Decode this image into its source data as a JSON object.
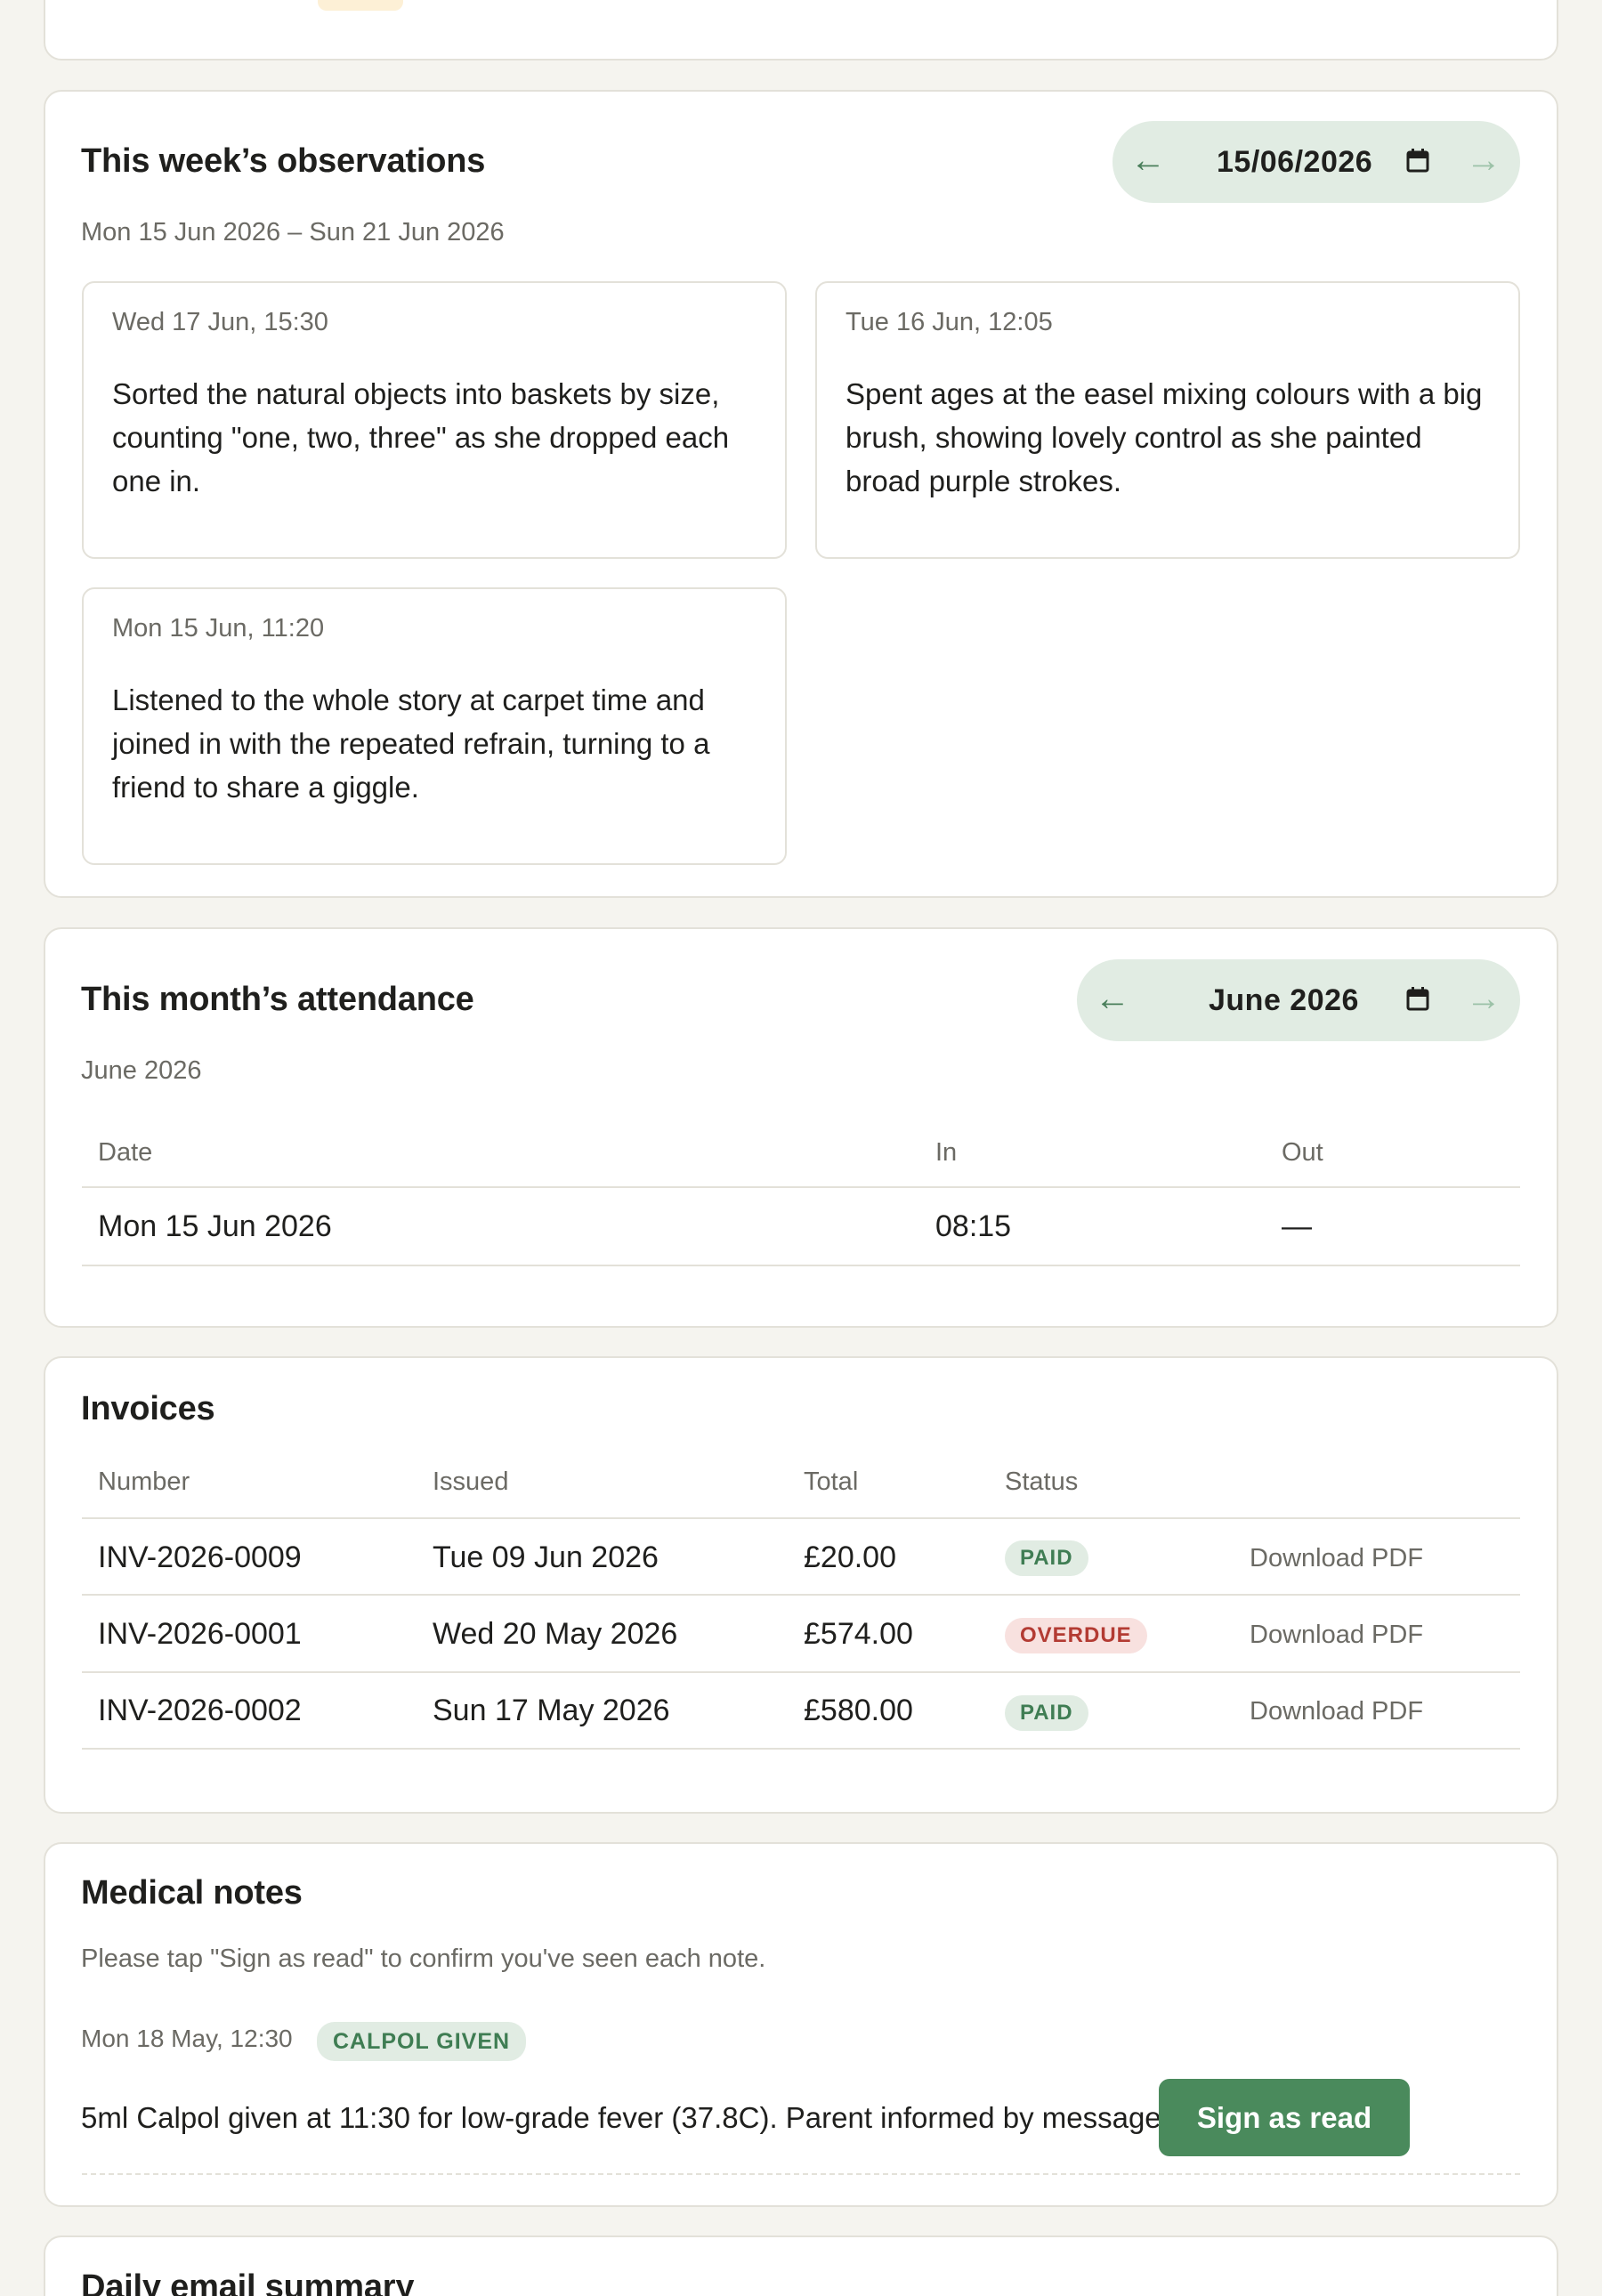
{
  "observations": {
    "title": "This week’s observations",
    "range": "Mon 15 Jun 2026 – Sun 21 Jun 2026",
    "date_value": "15/06/2026",
    "prev_arrow": "←",
    "next_arrow": "→",
    "items": [
      {
        "when": "Wed 17 Jun, 15:30",
        "text": "Sorted the natural objects into baskets by size, counting \"one, two, three\" as she dropped each one in."
      },
      {
        "when": "Tue 16 Jun, 12:05",
        "text": "Spent ages at the easel mixing colours with a big brush, showing lovely control as she painted broad purple strokes."
      },
      {
        "when": "Mon 15 Jun, 11:20",
        "text": "Listened to the whole story at carpet time and joined in with the repeated refrain, turning to a friend to share a giggle."
      }
    ]
  },
  "attendance": {
    "title": "This month’s attendance",
    "subtitle": "June 2026",
    "month_value": "June 2026",
    "prev_arrow": "←",
    "next_arrow": "→",
    "columns": [
      "Date",
      "In",
      "Out"
    ],
    "rows": [
      {
        "date": "Mon 15 Jun 2026",
        "in": "08:15",
        "out": "—"
      }
    ]
  },
  "invoices": {
    "title": "Invoices",
    "columns": [
      "Number",
      "Issued",
      "Total",
      "Status"
    ],
    "rows": [
      {
        "number": "INV-2026-0009",
        "issued": "Tue 09 Jun 2026",
        "total": "£20.00",
        "status": "PAID",
        "link": "Download PDF"
      },
      {
        "number": "INV-2026-0001",
        "issued": "Wed 20 May 2026",
        "total": "£574.00",
        "status": "OVERDUE",
        "link": "Download PDF"
      },
      {
        "number": "INV-2026-0002",
        "issued": "Sun 17 May 2026",
        "total": "£580.00",
        "status": "PAID",
        "link": "Download PDF"
      }
    ]
  },
  "medical": {
    "title": "Medical notes",
    "instructions": "Please tap \"Sign as read\" to confirm you've seen each note.",
    "note": {
      "when": "Mon 18 May, 12:30",
      "tag": "CALPOL GIVEN",
      "text": "5ml Calpol given at 11:30 for low-grade fever (37.8C). Parent informed by message.",
      "button": "Sign as read"
    }
  },
  "daily_summary": {
    "title": "Daily email summary"
  },
  "colors": {
    "accent": "#4a8a5c",
    "pill_bg": "#e1ece3",
    "paid_bg": "#e1ece3",
    "overdue_bg": "#f8e1df",
    "page_bg": "#f5f4ef"
  }
}
